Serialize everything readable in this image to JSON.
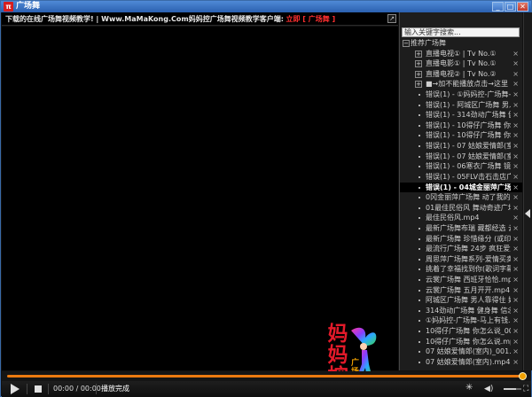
{
  "window": {
    "title": "广场舞",
    "app_icon": "π",
    "buttons": {
      "minimize": "_",
      "maximize": "□",
      "close": "✕"
    }
  },
  "marquee": {
    "text": "下载的在线广场舞视频教学! | Www.MaMaKong.Com妈妈控广场舞视频教学客户端:",
    "link": "立即 [ 广场舞 ]"
  },
  "search": {
    "placeholder": "输入关键字搜索..."
  },
  "playlist": {
    "root_label": "推荐广场舞",
    "items": [
      {
        "label": "直播电视① | Tv No.①",
        "kind": "group"
      },
      {
        "label": "直播电影① | Tv No.①",
        "kind": "group"
      },
      {
        "label": "直播电视② | Tv No.②",
        "kind": "group"
      },
      {
        "label": "■→加不能播放点击→这里",
        "kind": "group"
      },
      {
        "label": "错误(1) - ①妈妈控-广场舞-马上",
        "kind": "file"
      },
      {
        "label": "错误(1) - 阿城区广场舞 男人靠",
        "kind": "file"
      },
      {
        "label": "错误(1) - 314劲动广场舞 健身舞",
        "kind": "file"
      },
      {
        "label": "错误(1) - 10得仔广场舞 你怎么",
        "kind": "file"
      },
      {
        "label": "错误(1) - 10得仔广场舞 你怎么",
        "kind": "file"
      },
      {
        "label": "错误(1) - 07 姑娘爱情郎(室内)",
        "kind": "file"
      },
      {
        "label": "错误(1) - 07 姑娘爱情郎(室内)",
        "kind": "file"
      },
      {
        "label": "错误(1) - 06寒衣广场舞 镜上前",
        "kind": "file"
      },
      {
        "label": "错误(1) - 05FLV击石击店广场舞",
        "kind": "file"
      },
      {
        "label": "错误(1) - 04城金丽萍广场舞 三",
        "kind": "file",
        "active": true
      },
      {
        "label": "0冈金丽萍广场舞 动了我的情",
        "kind": "file"
      },
      {
        "label": "01最佳民俗风 舞动奇迹广场舞",
        "kind": "file"
      },
      {
        "label": "最佳民俗风.mp4",
        "kind": "file"
      },
      {
        "label": "最新广场舞布瑞 藏都经选 云裳",
        "kind": "file"
      },
      {
        "label": "最新广场舞 珍惜缘分 (或印商",
        "kind": "file"
      },
      {
        "label": "最流行广场舞 24步 疯狂爱爱爱",
        "kind": "file"
      },
      {
        "label": "周思萍广场舞系列-爱情买卖 含",
        "kind": "file"
      },
      {
        "label": "挑着了幸福找到你(歌词字幕).m",
        "kind": "file"
      },
      {
        "label": "云裳广场舞 西班牙恰恰.mp4",
        "kind": "file"
      },
      {
        "label": "云裳广场舞 五月开开.mp4",
        "kind": "file"
      },
      {
        "label": "阿城区广场舞 男人靠得住 好养",
        "kind": "file"
      },
      {
        "label": "314劲动广场舞 健身舞 信念情",
        "kind": "file"
      },
      {
        "label": "①妈妈控-广场舞-马上有钱.mp4",
        "kind": "file"
      },
      {
        "label": "10得仔广场舞 你怎么说_001.n",
        "kind": "file"
      },
      {
        "label": "10得仔广场舞 你怎么说.mp4",
        "kind": "file"
      },
      {
        "label": "07 姑娘爱情郎(室内)_001.n",
        "kind": "file"
      },
      {
        "label": "07 姑娘爱情郎(室内).mp4",
        "kind": "file"
      }
    ]
  },
  "watermark": {
    "chars": "妈妈控",
    "sub": "广场舞"
  },
  "controls": {
    "time": "00:00 / 00:00",
    "status": "播放完成",
    "progress": 1.0
  },
  "colors": {
    "accent": "#ec7a10",
    "title_bar": "#2b60b0",
    "link_red": "#ff2f2f"
  }
}
